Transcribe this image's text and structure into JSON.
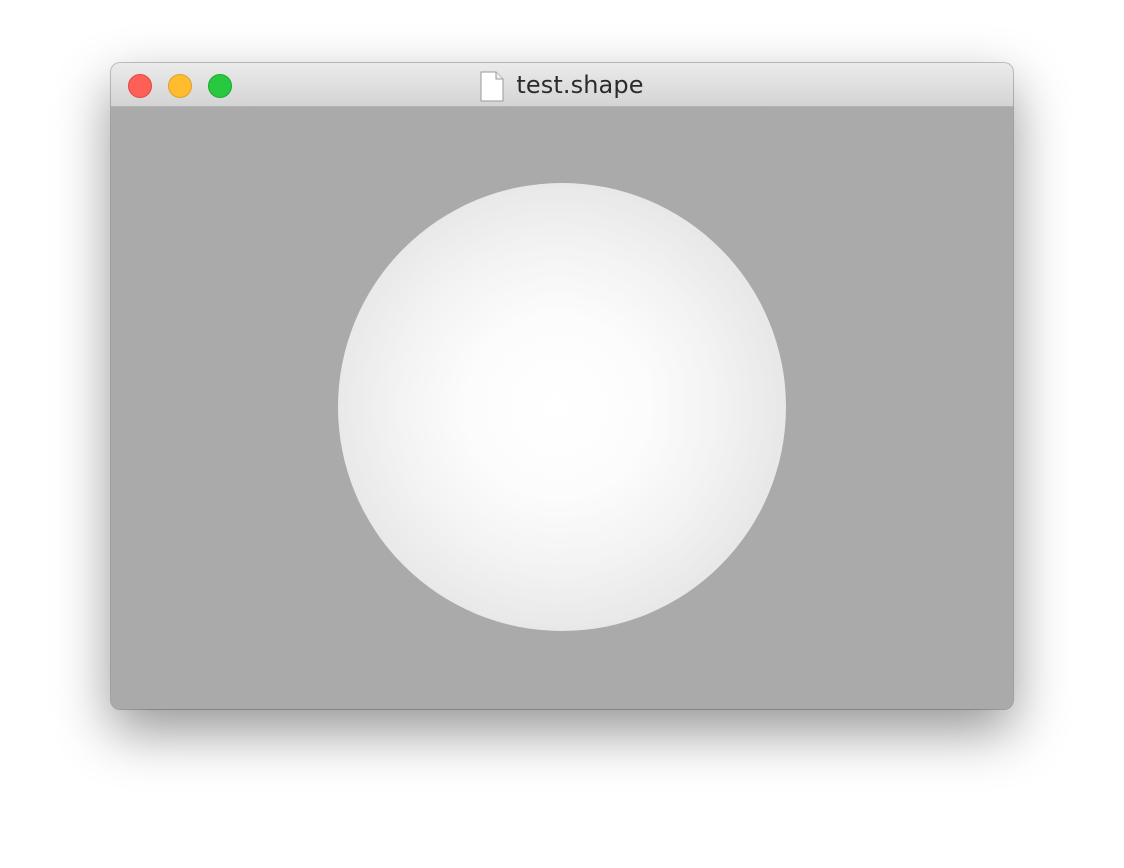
{
  "window": {
    "title": "test.shape",
    "document_icon": "document-icon"
  },
  "controls": {
    "close": {
      "icon": "close-icon",
      "color": "#ff5f57",
      "border": "#e2463f"
    },
    "minimize": {
      "icon": "minimize-icon",
      "color": "#febc2e",
      "border": "#dea123"
    },
    "zoom": {
      "icon": "zoom-icon",
      "color": "#28c840",
      "border": "#1aab29"
    }
  },
  "viewport": {
    "background": "#aaaaaa",
    "object": "sphere",
    "object_color": "#ffffff"
  }
}
